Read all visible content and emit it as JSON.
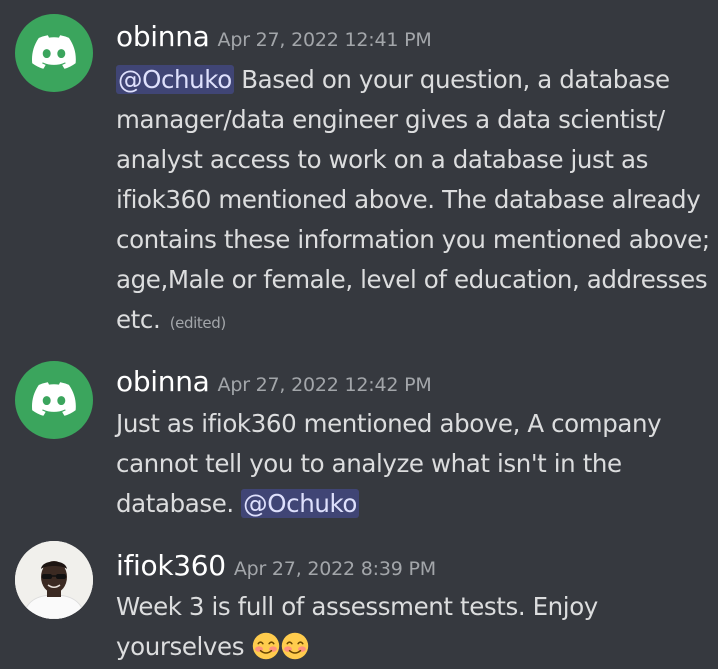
{
  "messages": [
    {
      "username": "obinna",
      "timestamp": "Apr 27, 2022 12:41 PM",
      "avatar_icon": "discord-logo-icon",
      "mention": "@Ochuko",
      "text": "Based on your question, a database manager/data engineer gives a data scientist/ analyst access to work on a database just as ifiok360 mentioned above. The database already contains these information you mentioned above; age,Male or female, level of education, addresses etc.",
      "edited_label": "(edited)"
    },
    {
      "username": "obinna",
      "timestamp": "Apr 27, 2022 12:42 PM",
      "avatar_icon": "discord-logo-icon",
      "text": "Just as ifiok360 mentioned above, A company cannot tell you to analyze what isn't in the database.",
      "mention": "@Ochuko"
    },
    {
      "username": "ifiok360",
      "timestamp": "Apr 27, 2022 8:39 PM",
      "avatar_icon": "user-photo-avatar",
      "text": "Week 3 is full of assessment tests. Enjoy yourselves",
      "emoji_icon": "smiling-face-with-smiling-eyes-icon"
    }
  ],
  "colors": {
    "background": "#36393f",
    "discord_green": "#3ba55d",
    "mention_bg": "rgba(88,101,242,0.3)"
  }
}
